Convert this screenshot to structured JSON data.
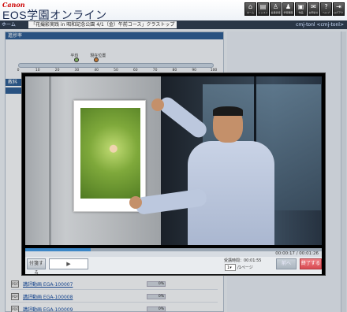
{
  "header": {
    "brand": "Canon",
    "title": "EOS学園オンライン",
    "icons": [
      {
        "name": "home-icon",
        "glyph": "⌂",
        "label": "ホーム"
      },
      {
        "name": "lesson-icon",
        "glyph": "▤",
        "label": "レッスン"
      },
      {
        "name": "info-icon",
        "glyph": "♙",
        "label": "会員情報"
      },
      {
        "name": "history-icon",
        "glyph": "♟",
        "label": "学習履歴"
      },
      {
        "name": "gallery-icon",
        "glyph": "▣",
        "label": "作品"
      },
      {
        "name": "mail-icon",
        "glyph": "✉",
        "label": "お問合せ"
      },
      {
        "name": "help-icon",
        "glyph": "?",
        "label": "ヘルプ"
      },
      {
        "name": "logout-icon",
        "glyph": "⇥",
        "label": "ログアウト"
      }
    ]
  },
  "crumbs": {
    "home": "ホーム",
    "course": "「花撮影実践 in 昭和記念公園 4/1（金）午前コース」クラストップ",
    "user": "cmj-tonl <cmj-tonl>"
  },
  "left": {
    "progress_header": "進捗率",
    "markers": [
      {
        "label": "平均",
        "value": 30
      },
      {
        "label": "現在位置",
        "value": 40
      }
    ],
    "ticks": [
      "0",
      "10",
      "20",
      "30",
      "40",
      "50",
      "60",
      "70",
      "80",
      "90",
      "100"
    ],
    "section_header": "教科",
    "rows": [
      {
        "icon": "PDF",
        "link": "講評動画 EGA-100007",
        "pct": "0%"
      },
      {
        "icon": "PDF",
        "link": "講評動画 EGA-100008",
        "pct": "0%"
      },
      {
        "icon": "PDF",
        "link": "講評動画 EGA-100009",
        "pct": "0%"
      }
    ]
  },
  "player": {
    "progress": 0.22,
    "elapsed": "00:00:17",
    "total": "00:01:26",
    "bookmark_label": "付箋する",
    "play_label": "▶",
    "speed_label": "受講時間：00:01:55",
    "page_select": "1",
    "page_suffix": "/1ページ",
    "prev_label": "前へ",
    "end_label": "終了する"
  },
  "colors": {
    "accent": "#2f5e93",
    "seek": "#3b86c6",
    "end_button": "#d84a52",
    "brand": "#cc0000"
  }
}
